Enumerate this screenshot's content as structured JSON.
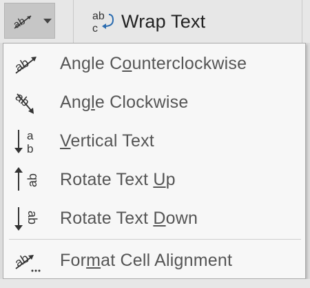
{
  "ribbon": {
    "orientation_button": {
      "icon": "angle-counterclockwise-icon"
    },
    "wrap_text": {
      "label": "Wrap Text",
      "icon": "wrap-text-icon"
    }
  },
  "menu": {
    "items": [
      {
        "label": "Angle Counterclockwise",
        "icon": "angle-counterclockwise-icon",
        "access_key": "o"
      },
      {
        "label": "Angle Clockwise",
        "icon": "angle-clockwise-icon",
        "access_key": "l"
      },
      {
        "label": "Vertical Text",
        "icon": "vertical-text-icon",
        "access_key": "V"
      },
      {
        "label": "Rotate Text Up",
        "icon": "rotate-text-up-icon",
        "access_key": "U"
      },
      {
        "label": "Rotate Text Down",
        "icon": "rotate-text-down-icon",
        "access_key": "D"
      },
      {
        "label": "Format Cell Alignment",
        "icon": "format-cell-alignment-icon",
        "access_key": "m"
      }
    ]
  },
  "colors": {
    "menu_bg": "#f7f7f7",
    "label_text": "#555555",
    "icon_blue": "#2b6cb0",
    "button_pressed_bg": "#c6c6c6"
  }
}
